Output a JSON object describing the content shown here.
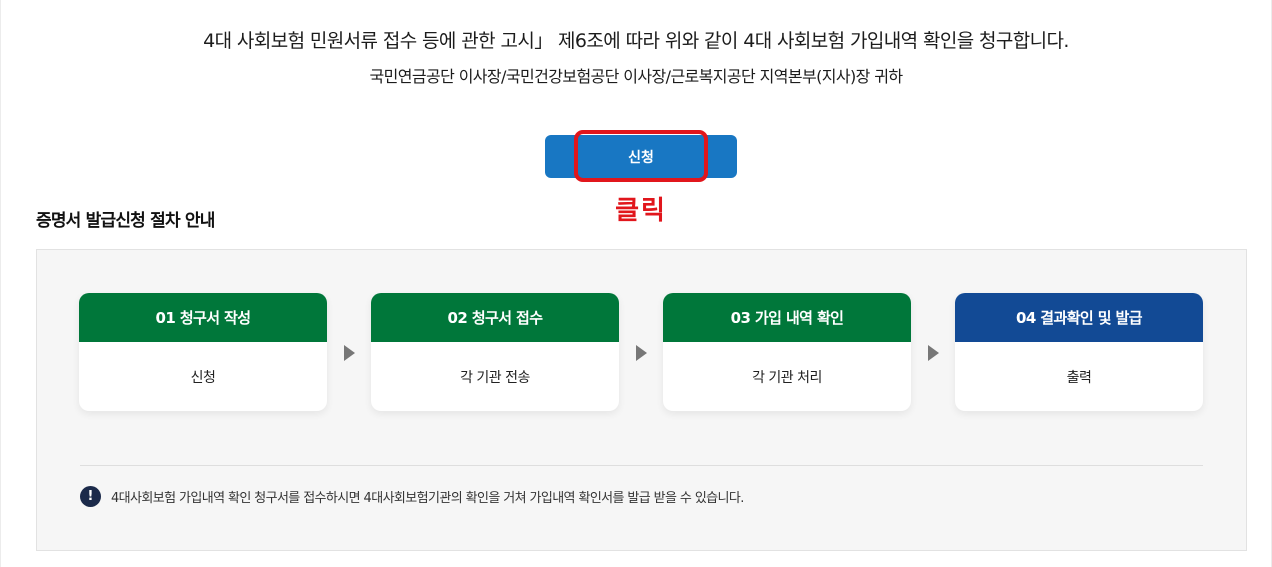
{
  "header": {
    "claim_text": "4대 사회보험 민원서류 접수 등에 관한 고시」 제6조에 따라 위와 같이 4대 사회보험 가입내역 확인을 청구합니다.",
    "recipient_text": "국민연금공단 이사장/국민건강보험공단 이사장/근로복지공단 지역본부(지사)장 귀하"
  },
  "apply_button": {
    "label": "신청",
    "color": "#1877c3"
  },
  "annotation": {
    "click_label": "클릭",
    "color": "#e1161c"
  },
  "procedure": {
    "title": "증명서 발급신청 절차 안내",
    "steps": [
      {
        "title": "01 청구서 작성",
        "desc": "신청",
        "color": "#00773a"
      },
      {
        "title": "02 청구서 접수",
        "desc": "각 기관 전송",
        "color": "#00773a"
      },
      {
        "title": "03 가입 내역 확인",
        "desc": "각 기관 처리",
        "color": "#00773a"
      },
      {
        "title": "04 결과확인 및 발급",
        "desc": "출력",
        "color": "#124a95"
      }
    ],
    "notice": {
      "icon": "exclamation-icon",
      "icon_glyph": "!",
      "text": "4대사회보험 가입내역 확인 청구서를 접수하시면 4대사회보험기관의 확인을 거쳐 가입내역 확인서를 발급 받을 수 있습니다."
    }
  }
}
